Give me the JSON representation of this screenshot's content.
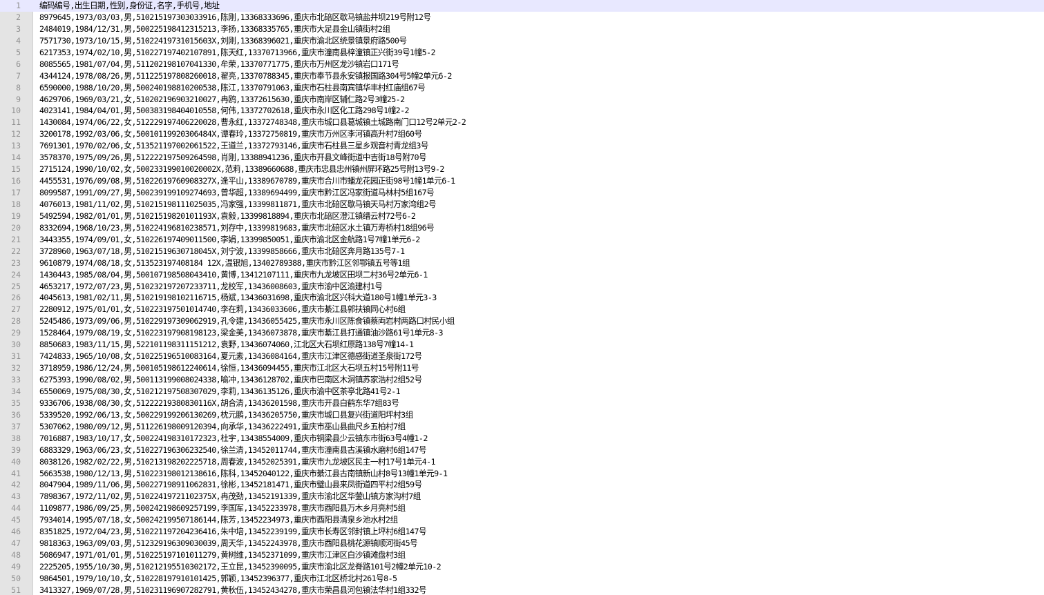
{
  "editor": {
    "lines": [
      "编码编号,出生日期,性别,身份证,名字,手机号,地址",
      "8979645,1973/03/03,男,510215197303033916,陈刚,13368333696,重庆市北碚区歇马镇盐井坝219号附12号",
      "2484019,1984/12/31,男,500225198412315213,李扬,13368335765,重庆市大足县金山镇街村2组",
      "7571730,1973/10/15,男,51022419731015603X,刘刚,13368396021,重庆市渝北区统景镇景府路500号",
      "6217353,1974/02/10,男,510227197402107891,陈天红,13370713966,重庆市潼南县梓潼镇正兴街39号1幢5-2",
      "8085565,1981/07/04,男,511202198107041330,牟荣,13370771775,重庆市万州区龙沙镇岩口171号",
      "4344124,1978/08/26,男,511225197808260018,翟亮,13370788345,重庆市奉节县永安镇报国路304号5幢2单元6-2",
      "6590000,1988/10/20,男,500240198810200538,陈江,13370791063,重庆市石柱县南宾镇华丰村红庙组67号",
      "4629706,1969/03/21,女,510202196903210027,冉鸥,13372615630,重庆市南岸区辅仁路2号3幢25-2",
      "4023141,1984/04/01,男,500383198404010558,何伟,13372702618,重庆市永川区化工路298号1幢2-2",
      "1430084,1974/06/22,女,512229197406220028,曹永红,13372748348,重庆市城口县葛城镇土城路南门口12号2单元2-2",
      "3200178,1992/03/06,女,50010119920306484X,谭春玲,13372750819,重庆市万州区李河镇高升村7组60号",
      "7691301,1970/02/06,女,513521197002061522,王道兰,13372793146,重庆市石柱县三星乡观音村青龙组3号",
      "3578370,1975/09/26,男,512222197509264598,肖刚,13388941236,重庆市开县文峰街道中吉街18号附70号",
      "2715124,1990/10/02,女,500233199010020002X,范莉,13389660688,重庆市忠县忠州镇州屏环路25号附13号9-2",
      "4455531,1976/09/08,男,51022619760908327X,逄平山,13389670789,重庆市合川市蟠龙花园正街98号1幢1单元6-1",
      "8099587,1991/09/27,男,500239199109274693,曾华超,13389694499,重庆市黔江区冯家街道马林村5组167号",
      "4076013,1981/11/02,男,510215198111025035,冯家强,13399811871,重庆市北碚区歇马镇天马村万家湾组2号",
      "5492594,1982/01/01,男,51021519820101193X,袁毅,13399818894,重庆市北碚区澄江镇缙云村72号6-2",
      "8332694,1968/10/23,男,510224196810238571,刘存中,13399819683,重庆市北碚区水土镇万寿桥村18组96号",
      "3443355,1974/09/01,女,510226197409011500,李娟,13399850051,重庆市渝北区金航路1号7幢1单元6-2",
      "3728960,1963/07/18,男,51021519630718045X,刘宁波,13399858666,重庆市北碚区奔月路135号7-1",
      "9610879,1974/08/18,女,513523197408184 12X,温银旭,13402789388,重庆市黔江区邻鄂镇五号等1组",
      "1430443,1985/08/04,男,500107198508043410,黄博,13412107111,重庆市九龙坡区田坝二村36号2单元6-1",
      "4653217,1972/07/23,男,510232197207233711,龙校军,13436008603,重庆市渝中区渝建村1号",
      "4045613,1981/02/11,男,510219198102116715,杨斌,13436031698,重庆市渝北区兴科大道180号1幢1单元3-3",
      "2280912,1975/01/01,女,510223197501014740,李在莉,13436033606,重庆市綦江县郭扶镇同心村6组",
      "5245486,1973/09/06,男,510229197309062919,孔令建,13436055425,重庆市永川区陈食镇蔡両岩村两路口村民小组",
      "1528464,1979/08/19,女,510223197908198123,梁金美,13436073878,重庆市綦江县打通镇油沙路61号1单元8-3",
      "8850683,1983/11/15,男,522101198311151212,袁野,13436074060,江北区大石坝红原路138号7幢14-1",
      "7424833,1965/10/08,女,510225196510083164,夏元素,13436084164,重庆市江津区德感街道圣泉街172号",
      "3718959,1986/12/24,男,500105198612240614,徐恒,13436094455,重庆市江北区大石坝五村15号附11号",
      "6275393,1990/08/02,男,500113199008024338,喻冲,13436128702,重庆市巴南区木洞镇苏家浩村2组52号",
      "6550069,1975/08/30,女,510212197508307029,李莉,13436135126,重庆市渝中区茶亭北路41号2-1",
      "9336706,1938/08/30,女,51222219380830116X,胡合清,13436201598,重庆市开县白鹤东华7组83号",
      "5339520,1992/06/13,女,500229199206130269,枕元鹏,13436205750,重庆市城口县复兴街道阳坪村3组",
      "5307062,1980/09/12,男,511226198009120394,向承华,13436222491,重庆市巫山县曲尺乡五柏村7组",
      "7016887,1983/10/17,女,500224198310172323,杜宇,13438554009,重庆市铜梁县少云镇东市街63号4幢1-2",
      "6883329,1963/06/23,女,510227196306232540,徐兰清,13452011744,重庆市潼南县古溪镇水磨村6组147号",
      "8038126,1982/02/22,男,510213198202225718,周春波,13452025391,重庆市九龙坡区民主一村17号1单元4-1",
      "5663538,1980/12/13,男,510223198012138616,陈科,13452040122,重庆市綦江县古南镇新山村8号13幢1单元9-1",
      "8047904,1989/11/06,男,500227198911062831,徐彬,13452181471,重庆市璧山县来凤街道四平村2组59号",
      "7898367,1972/11/02,男,51022419721102375X,冉茂劲,13452191339,重庆市渝北区华蓥山镇方家沟村7组",
      "1109877,1986/09/25,男,500242198609257199,李国军,13452233978,重庆市酉阳县万木乡月亮村5组",
      "7934014,1995/07/18,女,500242199507186144,陈芳,13452234973,重庆市酉阳县清泉乡池水村2组",
      "8351825,1972/04/23,男,510221197204236416,朱中培,13452239199,重庆市长寿区邻封镇上坪村6组147号",
      "9818363,1963/09/03,男,512329196309030039,周天华,13452243978,重庆市酉阳县桃花源镇顺河街45号",
      "5086947,1971/01/01,男,510225197101011279,黄树维,13452371099,重庆市江津区白沙镇滩盘村3组",
      "2225205,1955/10/30,男,510212195510302172,王立昆,13452390095,重庆市渝北区龙脊路101号2幢2单元10-2",
      "9864501,1979/10/10,女,510228197910101425,郭颖,13452396377,重庆市江北区桥北村261号8-5",
      "3413327,1969/07/28,男,510231196907282791,黄秋伍,13452434278,重庆市荣昌县河包镇法华村1组332号"
    ]
  }
}
